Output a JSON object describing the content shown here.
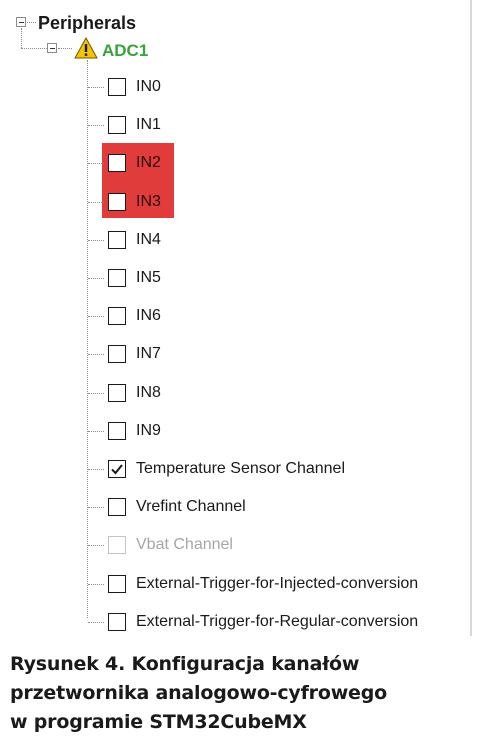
{
  "tree": {
    "root_label": "Peripherals",
    "node_label": "ADC1",
    "node_color": "#3aa33a",
    "highlight_color": "#e03c3c",
    "items": [
      {
        "label": "IN0",
        "checked": false,
        "enabled": true,
        "highlighted": false
      },
      {
        "label": "IN1",
        "checked": false,
        "enabled": true,
        "highlighted": false
      },
      {
        "label": "IN2",
        "checked": false,
        "enabled": true,
        "highlighted": true
      },
      {
        "label": "IN3",
        "checked": false,
        "enabled": true,
        "highlighted": true
      },
      {
        "label": "IN4",
        "checked": false,
        "enabled": true,
        "highlighted": false
      },
      {
        "label": "IN5",
        "checked": false,
        "enabled": true,
        "highlighted": false
      },
      {
        "label": "IN6",
        "checked": false,
        "enabled": true,
        "highlighted": false
      },
      {
        "label": "IN7",
        "checked": false,
        "enabled": true,
        "highlighted": false
      },
      {
        "label": "IN8",
        "checked": false,
        "enabled": true,
        "highlighted": false
      },
      {
        "label": "IN9",
        "checked": false,
        "enabled": true,
        "highlighted": false
      },
      {
        "label": "Temperature Sensor Channel",
        "checked": true,
        "enabled": true,
        "highlighted": false
      },
      {
        "label": "Vrefint Channel",
        "checked": false,
        "enabled": true,
        "highlighted": false
      },
      {
        "label": "Vbat Channel",
        "checked": false,
        "enabled": false,
        "highlighted": false
      },
      {
        "label": "External-Trigger-for-Injected-conversion",
        "checked": false,
        "enabled": true,
        "highlighted": false
      },
      {
        "label": "External-Trigger-for-Regular-conversion",
        "checked": false,
        "enabled": true,
        "highlighted": false
      }
    ]
  },
  "icons": {
    "root_expander": "collapse-icon",
    "node_expander": "collapse-icon",
    "node_status": "warning-icon"
  },
  "caption": {
    "line1": "Rysunek 4. Konfiguracja kanałów",
    "line2": "przetwornika analogowo-cyfrowego",
    "line3": "w programie STM32CubeMX"
  }
}
